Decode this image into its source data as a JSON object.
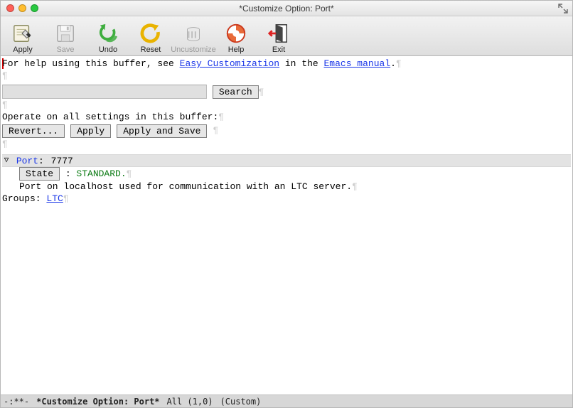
{
  "window": {
    "title": "*Customize Option: Port*"
  },
  "toolbar": {
    "apply": "Apply",
    "save": "Save",
    "undo": "Undo",
    "reset": "Reset",
    "uncustomize": "Uncustomize",
    "help": "Help",
    "exit": "Exit"
  },
  "help_line": {
    "prefix": "For help using this buffer, see ",
    "link1": "Easy Customization",
    "mid": " in the ",
    "link2": "Emacs manual",
    "suffix": "."
  },
  "search": {
    "button": "Search"
  },
  "operate_line": "Operate on all settings in this buffer:",
  "buttons": {
    "revert": "Revert...",
    "apply": "Apply",
    "apply_save": "Apply and Save"
  },
  "option": {
    "triangle": "▽",
    "name": "Port",
    "value": "7777",
    "state_button": "State",
    "state_value": "STANDARD.",
    "description": "Port on localhost used for communication with an LTC server."
  },
  "groups": {
    "label": "Groups: ",
    "link": "LTC"
  },
  "modeline": {
    "left": "-:**-",
    "buffer": "*Customize Option: Port*",
    "pos": "All (1,0)",
    "mode": "(Custom)"
  },
  "pilcrow": "¶"
}
